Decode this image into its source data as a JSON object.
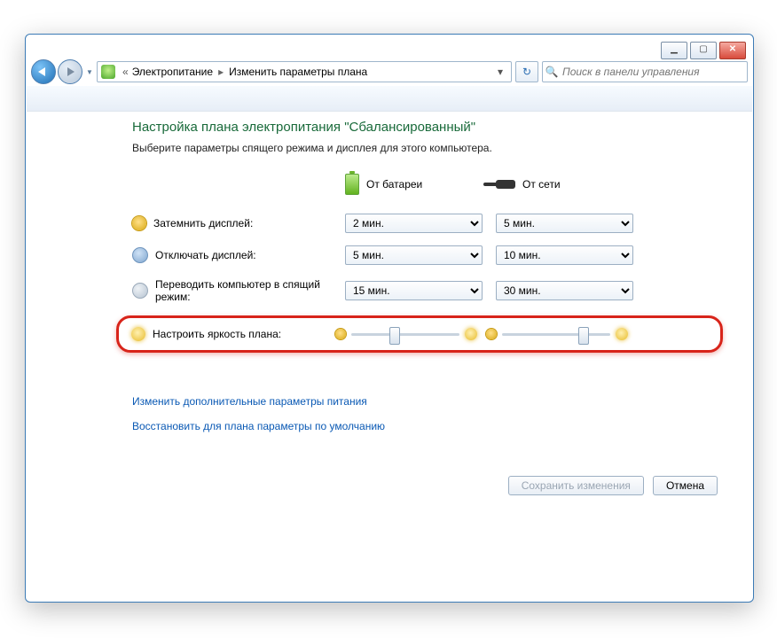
{
  "breadcrumb": {
    "item1": "Электропитание",
    "item2": "Изменить параметры плана"
  },
  "search": {
    "placeholder": "Поиск в панели управления"
  },
  "heading": "Настройка плана электропитания \"Сбалансированный\"",
  "subheading": "Выберите параметры спящего режима и дисплея для этого компьютера.",
  "columns": {
    "battery": "От батареи",
    "plugged": "От сети"
  },
  "rows": {
    "dim": {
      "label": "Затемнить дисплей:",
      "battery": "2 мин.",
      "plugged": "5 мин."
    },
    "off": {
      "label": "Отключать дисплей:",
      "battery": "5 мин.",
      "plugged": "10 мин."
    },
    "sleep": {
      "label": "Переводить компьютер в спящий режим:",
      "battery": "15 мин.",
      "plugged": "30 мин."
    },
    "bright": {
      "label": "Настроить яркость плана:",
      "battery_pct": 40,
      "plugged_pct": 75
    }
  },
  "links": {
    "advanced": "Изменить дополнительные параметры питания",
    "restore": "Восстановить для плана параметры по умолчанию"
  },
  "buttons": {
    "save": "Сохранить изменения",
    "cancel": "Отмена"
  },
  "titlebar": {
    "min": "▁",
    "max": "▢",
    "close": "✕"
  }
}
